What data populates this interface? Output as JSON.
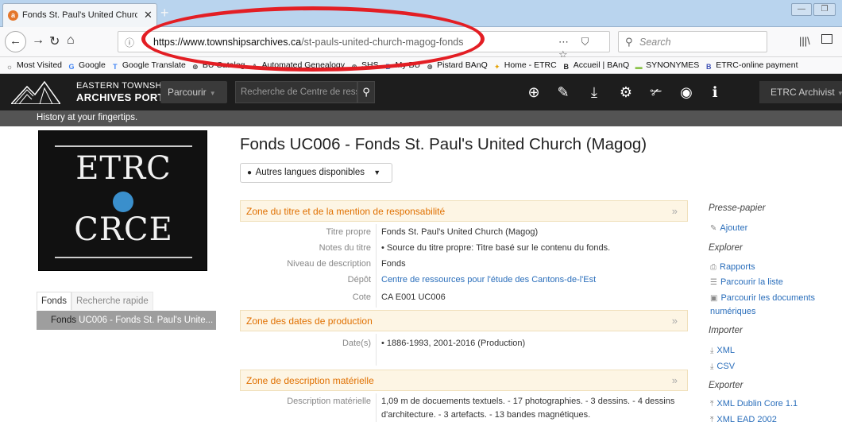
{
  "browser": {
    "tab_title": "Fonds St. Paul's United Church",
    "tab_favicon": "a",
    "url_host": "https://www.townshipsarchives.ca",
    "url_path": "/st-pauls-united-church-magog-fonds",
    "search_placeholder": "Search",
    "bookmarks": [
      {
        "label": "Most Visited",
        "icon": "gear-icon",
        "color": "#555555"
      },
      {
        "label": "Google",
        "icon": "google-icon",
        "color": "#4285f4"
      },
      {
        "label": "Google Translate",
        "icon": "translate-icon",
        "color": "#4285f4"
      },
      {
        "label": "BU Catalog",
        "icon": "globe-icon",
        "color": "#444444"
      },
      {
        "label": "Automated Genealogy",
        "icon": "ag-icon",
        "color": "#666666"
      },
      {
        "label": "SHS",
        "icon": "globe-icon",
        "color": "#444444"
      },
      {
        "label": "My BU",
        "icon": "bu-icon",
        "color": "#2d6fb5"
      },
      {
        "label": "Pistard BAnQ",
        "icon": "globe-icon",
        "color": "#444444"
      },
      {
        "label": "Home - ETRC",
        "icon": "etrc-icon",
        "color": "#e5a100"
      },
      {
        "label": "Accueil | BAnQ",
        "icon": "banq-icon",
        "color": "#222222"
      },
      {
        "label": "SYNONYMES",
        "icon": "syn-icon",
        "color": "#8bc34a"
      },
      {
        "label": "ETRC-online payment",
        "icon": "bu-icon",
        "color": "#3f51b5"
      }
    ]
  },
  "site": {
    "logo_line1": "EASTERN TOWNSHIPS",
    "logo_line2": "ARCHIVES PORTAL",
    "browse_label": "Parcourir",
    "search_placeholder": "Recherche de Centre de ressources pour l'ét",
    "user_menu": "ETRC Archivist",
    "tagline": "History at your fingertips."
  },
  "left": {
    "logo_top": "ETRC",
    "logo_bottom": "CRCE",
    "tab_fonds": "Fonds",
    "tab_quick": "Recherche rapide",
    "tree_prefix": "Fonds",
    "tree_text": "UC006 - Fonds St. Paul's Unite..."
  },
  "main": {
    "title": "Fonds UC006 - Fonds St. Paul's United Church (Magog)",
    "languages_btn": "Autres langues disponibles",
    "sections": [
      {
        "title": "Zone du titre et de la mention de responsabilité"
      },
      {
        "title": "Zone des dates de production"
      },
      {
        "title": "Zone de description matérielle"
      }
    ],
    "fields": {
      "titre_label": "Titre propre",
      "titre_value": "Fonds St. Paul's United Church (Magog)",
      "notes_label": "Notes du titre",
      "notes_value": "• Source du titre propre: Titre basé sur le contenu du fonds.",
      "niveau_label": "Niveau de description",
      "niveau_value": "Fonds",
      "depot_label": "Dépôt",
      "depot_value": "Centre de ressources pour l'étude des Cantons-de-l'Est",
      "cote_label": "Cote",
      "cote_value": "CA E001 UC006",
      "dates_label": "Date(s)",
      "dates_value": "• 1886-1993, 2001-2016 (Production)",
      "desc_label": "Description matérielle",
      "desc_value_1": "1,09 m de docuements textuels. - 17 photographies. - 3 dessins. - 4 dessins",
      "desc_value_2": "d'architecture. - 3 artefacts. - 13 bandes magnétiques."
    }
  },
  "sidebar": {
    "clipboard_head": "Presse-papier",
    "add": "Ajouter",
    "explore_head": "Explorer",
    "reports": "Rapports",
    "browse_list": "Parcourir la liste",
    "browse_digital_1": "Parcourir les documents",
    "browse_digital_2": "numériques",
    "import_head": "Importer",
    "import_xml": "XML",
    "import_csv": "CSV",
    "export_head": "Exporter",
    "export_dc": "XML Dublin Core 1.1",
    "export_ead": "XML EAD 2002"
  },
  "colors": {
    "annotation": "#e31e24",
    "section_title": "#e07000",
    "link": "#2a6ebb",
    "header_bg": "#1d1d1d"
  }
}
